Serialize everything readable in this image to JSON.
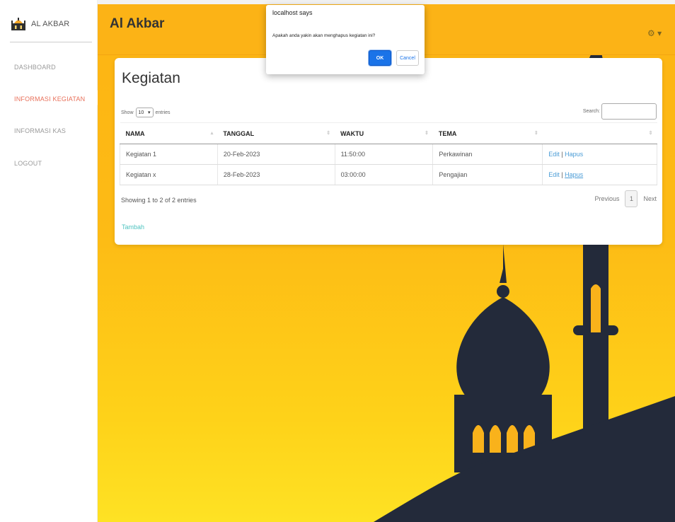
{
  "sidebar": {
    "brand": "AL AKBAR",
    "items": [
      {
        "label": "DASHBOARD"
      },
      {
        "label": "INFORMASI KEGIATAN"
      },
      {
        "label": "INFORMASI KAS"
      },
      {
        "label": "LOGOUT"
      }
    ],
    "active_index": 1
  },
  "header": {
    "title": "Al Akbar",
    "settings_icon": "gear-icon"
  },
  "card": {
    "title": "Kegiatan",
    "length": {
      "prefix": "Show",
      "value": "10",
      "suffix": "entries"
    },
    "search_label": "Search:",
    "columns": [
      "NAMA",
      "TANGGAL",
      "WAKTU",
      "TEMA",
      ""
    ],
    "rows": [
      {
        "nama": "Kegiatan 1",
        "tanggal": "20-Feb-2023",
        "waktu": "11:50:00",
        "tema": "Perkawinan",
        "edit": "Edit",
        "sep": "|",
        "hapus": "Hapus"
      },
      {
        "nama": "Kegiatan x",
        "tanggal": "28-Feb-2023",
        "waktu": "03:00:00",
        "tema": "Pengajian",
        "edit": "Edit",
        "sep": "|",
        "hapus": "Hapus"
      }
    ],
    "info": "Showing 1 to 2 of 2 entries",
    "pager": {
      "previous": "Previous",
      "page": "1",
      "next": "Next"
    },
    "add_link": "Tambah"
  },
  "dialog": {
    "title": "localhost says",
    "message": "Apakah anda yakin akan menghapus kegiatan ini?",
    "ok": "OK",
    "cancel": "Cancel"
  },
  "colors": {
    "accent_yellow": "#fcb316",
    "active_nav": "#e8705a",
    "link": "#4a9cd6",
    "tambah": "#4ec3c0",
    "silhouette": "#232a3a",
    "dialog_ok": "#1a73e8"
  }
}
